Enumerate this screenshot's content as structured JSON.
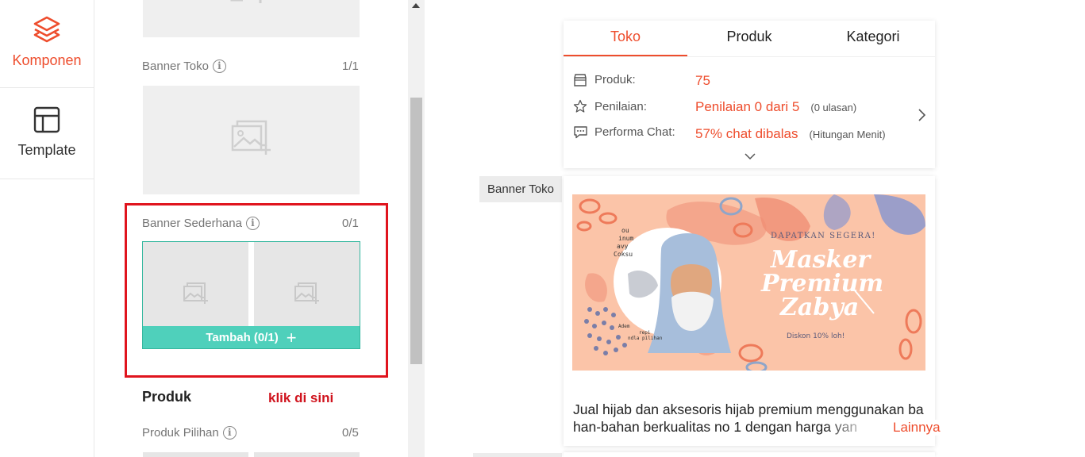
{
  "sidebar": {
    "komponen_label": "Komponen",
    "template_label": "Template"
  },
  "panel": {
    "banner_toko": {
      "title": "Banner Toko",
      "count": "1/1"
    },
    "banner_sederhana": {
      "title": "Banner Sederhana",
      "count": "0/1",
      "add_label": "Tambah (0/1)"
    },
    "produk_heading": "Produk",
    "produk_pilihan": {
      "title": "Produk Pilihan",
      "count": "0/5"
    },
    "annotation": "klik di sini"
  },
  "preview": {
    "tabs": [
      "Toko",
      "Produk",
      "Kategori"
    ],
    "active_tab": "Toko",
    "stats": {
      "produk_label": "Produk:",
      "produk_value": "75",
      "penilaian_label": "Penilaian:",
      "penilaian_value": "Penilaian 0 dari 5",
      "penilaian_note": "(0 ulasan)",
      "chat_label": "Performa Chat:",
      "chat_value": "57% chat dibalas",
      "chat_note": "(Hitungan Menit)"
    },
    "banner_tag": "Banner Toko",
    "banner": {
      "headline_small": "DAPATKAN SEGERA!",
      "title_line1": "Masker",
      "title_line2": "Premium",
      "title_line3": "Zabya",
      "discount": "Diskon 10% loh!",
      "side_text": [
        "ou",
        "inum",
        "avy",
        "Coksu"
      ],
      "side_text2": [
        "Adem",
        "repi",
        "ndla pilihan"
      ]
    },
    "description_line1": "Jual hijab dan aksesoris hijab premium menggunakan ba",
    "description_line2": "han-bahan berkualitas no 1 dengan harga yan",
    "more_label": "Lainnya"
  },
  "colors": {
    "accent": "#ee4d2d",
    "teal": "#4fd0bb",
    "highlight_red": "#e0141e"
  }
}
